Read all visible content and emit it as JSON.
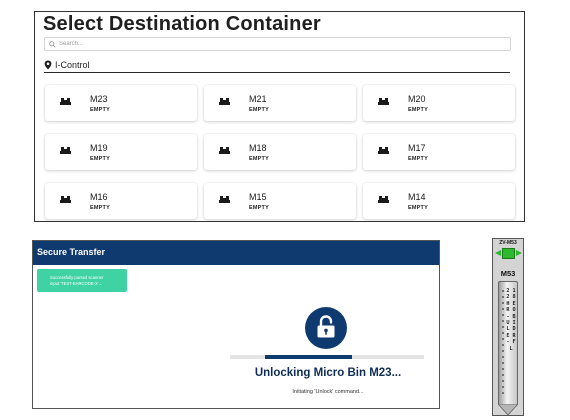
{
  "selector": {
    "title": "Select Destination Container",
    "search_placeholder": "Search...",
    "location": "I-Control",
    "containers": [
      {
        "name": "M23",
        "status": "EMPTY"
      },
      {
        "name": "M21",
        "status": "EMPTY"
      },
      {
        "name": "M20",
        "status": "EMPTY"
      },
      {
        "name": "M19",
        "status": "EMPTY"
      },
      {
        "name": "M18",
        "status": "EMPTY"
      },
      {
        "name": "M17",
        "status": "EMPTY"
      },
      {
        "name": "M16",
        "status": "EMPTY"
      },
      {
        "name": "M15",
        "status": "EMPTY"
      },
      {
        "name": "M14",
        "status": "EMPTY"
      }
    ]
  },
  "transfer": {
    "title": "Secure Transfer",
    "toast_line1": "Successfully parsed scanner",
    "toast_line2": "input 'TEST-BARCODE-X'...",
    "toast_color": "#3fd3a3",
    "header_color": "#0f3a70",
    "progress": 0.45,
    "status": "Unlocking Micro Bin M23...",
    "substatus": "Initiating 'Unlock' command..."
  },
  "bin_label": {
    "top_label": "ZV-M53",
    "name": "M53",
    "vertical_text": "2 1 2 8 H E R O - B U I L D E R - F L",
    "indicator_color": "#2eb82e"
  }
}
